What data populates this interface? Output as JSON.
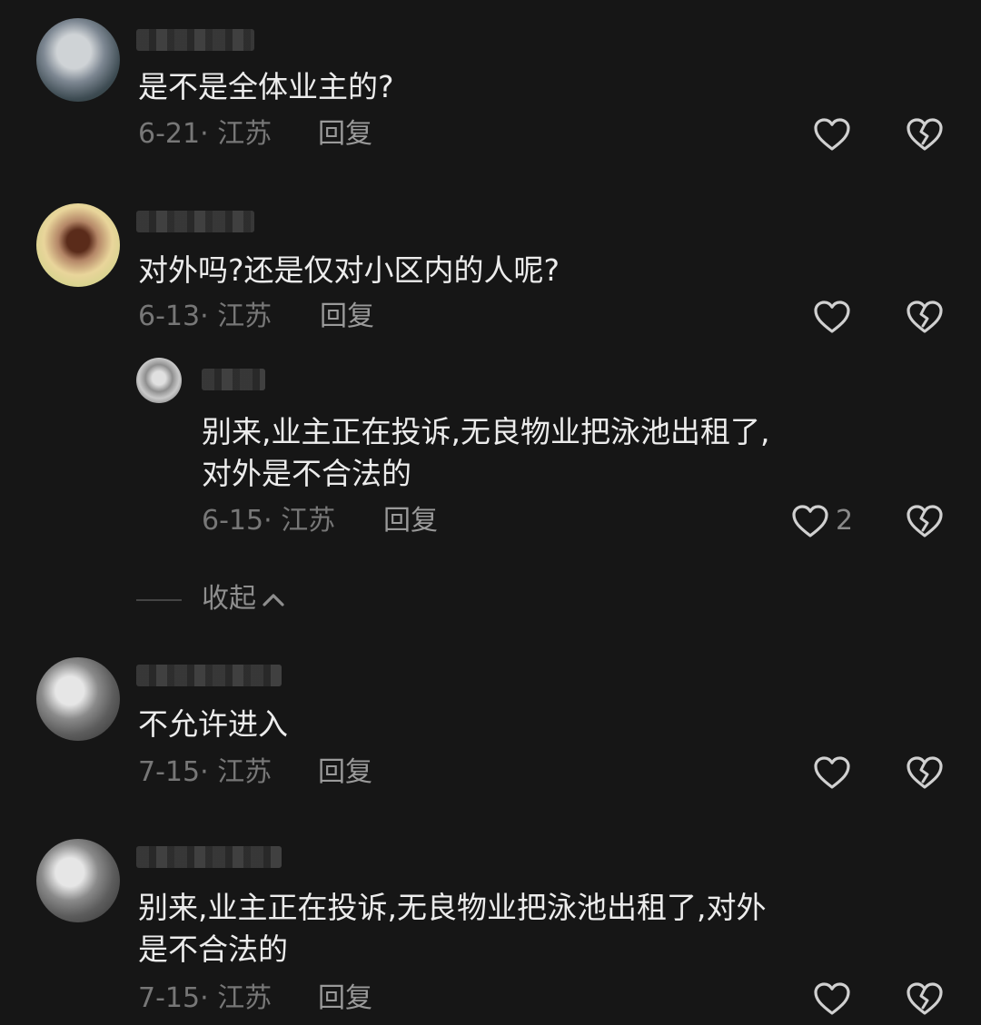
{
  "comments": [
    {
      "text": "是不是全体业主的?",
      "date": "6-21",
      "location": "江苏",
      "reply_label": "回复"
    },
    {
      "text": "对外吗?还是仅对小区内的人呢?",
      "date": "6-13",
      "location": "江苏",
      "reply_label": "回复",
      "replies": [
        {
          "text_line1": "别来,业主正在投诉,无良物业把泳池出租了,",
          "text_line2": "对外是不合法的",
          "date": "6-15",
          "location": "江苏",
          "reply_label": "回复",
          "like_count": "2"
        }
      ],
      "collapse_label": "收起"
    },
    {
      "text": "不允许进入",
      "date": "7-15",
      "location": "江苏",
      "reply_label": "回复"
    },
    {
      "text_line1": "别来,业主正在投诉,无良物业把泳池出租了,对外",
      "text_line2": "是不合法的",
      "date": "7-15",
      "location": "江苏",
      "reply_label": "回复"
    }
  ],
  "meta_separator": "·",
  "icons": {
    "like": "heart-outline-icon",
    "dislike": "broken-heart-icon",
    "collapse": "chevron-up-icon"
  },
  "colors": {
    "background": "#161616",
    "text": "#ececec",
    "meta": "#777777"
  }
}
